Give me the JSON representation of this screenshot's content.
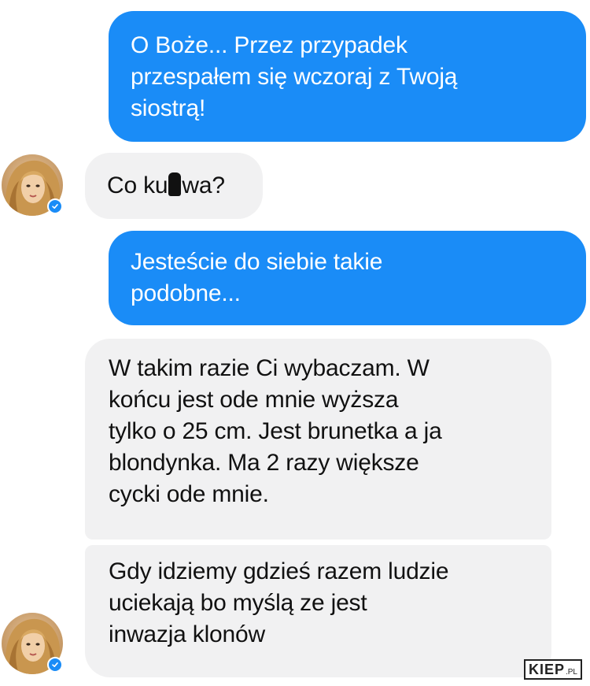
{
  "messages": [
    {
      "id": "msg-1",
      "direction": "outgoing",
      "text": "O Boże... Przez przypadek\nprzespałem się wczoraj z Twoją\nsiostrą!"
    },
    {
      "id": "msg-2",
      "direction": "incoming",
      "text_before": "Co ku",
      "text_after": "wa?"
    },
    {
      "id": "msg-3",
      "direction": "outgoing",
      "text": "Jesteście do siebie takie\npodobne..."
    },
    {
      "id": "msg-4",
      "direction": "incoming",
      "text": "W takim razie Ci wybaczam. W\nkońcu jest ode mnie wyższa\ntylko o 25 cm. Jest brunetka a ja\nblondynka. Ma 2 razy większe\ncycki ode mnie."
    },
    {
      "id": "msg-5",
      "direction": "incoming",
      "text": "Gdy idziemy gdzieś razem ludzie\nuciekają bo myślą ze jest\ninwazja klonów"
    }
  ],
  "avatars": [
    {
      "id": "avatar-1",
      "icon": "profile-photo",
      "badge": "verified-check-icon"
    },
    {
      "id": "avatar-2",
      "icon": "profile-photo",
      "badge": "verified-check-icon"
    }
  ],
  "watermark": {
    "main": "KIEP",
    "suffix": ".PL"
  },
  "colors": {
    "outgoing_bubble": "#1a8cf7",
    "incoming_bubble": "#f1f1f2",
    "outgoing_text": "#ffffff",
    "incoming_text": "#111111",
    "verified_badge": "#1a8cf7"
  }
}
